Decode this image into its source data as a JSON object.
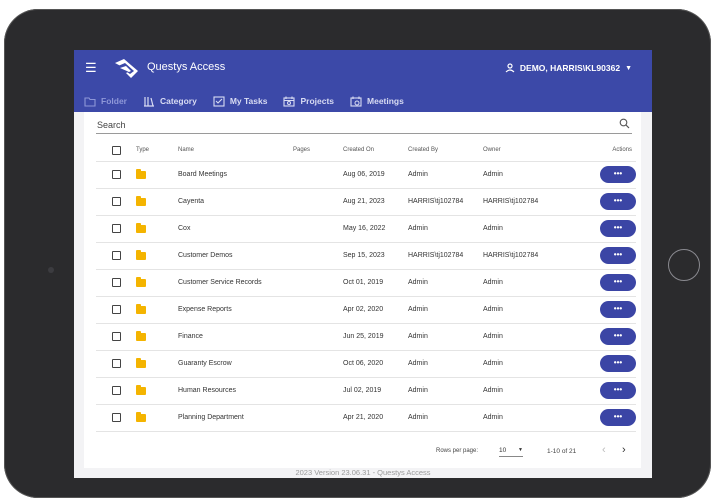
{
  "app": {
    "title": "Questys Access",
    "user_label": "DEMO, HARRIS\\KL90362"
  },
  "tabs": [
    {
      "label": "Folder",
      "icon": "folder-outline-icon"
    },
    {
      "label": "Category",
      "icon": "library-icon"
    },
    {
      "label": "My Tasks",
      "icon": "tasks-icon"
    },
    {
      "label": "Projects",
      "icon": "calendar-icon"
    },
    {
      "label": "Meetings",
      "icon": "calendar-clock-icon"
    }
  ],
  "search": {
    "placeholder": "Search"
  },
  "table": {
    "headers": {
      "type": "Type",
      "name": "Name",
      "pages": "Pages",
      "created_on": "Created On",
      "created_by": "Created By",
      "owner": "Owner",
      "actions": "Actions"
    },
    "rows": [
      {
        "name": "Board Meetings",
        "pages": "",
        "created_on": "Aug 06, 2019",
        "created_by": "Admin",
        "owner": "Admin"
      },
      {
        "name": "Cayenta",
        "pages": "",
        "created_on": "Aug 21, 2023",
        "created_by": "HARRIS\\tj102784",
        "owner": "HARRIS\\tj102784"
      },
      {
        "name": "Cox",
        "pages": "",
        "created_on": "May 16, 2022",
        "created_by": "Admin",
        "owner": "Admin"
      },
      {
        "name": "Customer Demos",
        "pages": "",
        "created_on": "Sep 15, 2023",
        "created_by": "HARRIS\\tj102784",
        "owner": "HARRIS\\tj102784"
      },
      {
        "name": "Customer Service Records",
        "pages": "",
        "created_on": "Oct 01, 2019",
        "created_by": "Admin",
        "owner": "Admin"
      },
      {
        "name": "Expense Reports",
        "pages": "",
        "created_on": "Apr 02, 2020",
        "created_by": "Admin",
        "owner": "Admin"
      },
      {
        "name": "Finance",
        "pages": "",
        "created_on": "Jun 25, 2019",
        "created_by": "Admin",
        "owner": "Admin"
      },
      {
        "name": "Guaranty Escrow",
        "pages": "",
        "created_on": "Oct 06, 2020",
        "created_by": "Admin",
        "owner": "Admin"
      },
      {
        "name": "Human Resources",
        "pages": "",
        "created_on": "Jul 02, 2019",
        "created_by": "Admin",
        "owner": "Admin"
      },
      {
        "name": "Planning Department",
        "pages": "",
        "created_on": "Apr 21, 2020",
        "created_by": "Admin",
        "owner": "Admin"
      }
    ],
    "action_label": "•••"
  },
  "pagination": {
    "rows_per_page_label": "Rows per page:",
    "rows_per_page": "10",
    "range": "1-10 of 21",
    "prev": "‹",
    "next": "›"
  },
  "footer": {
    "version": "2023 Version 23.06.31 - Questys Access"
  },
  "colors": {
    "appbar": "#3c49a8",
    "action_button": "#3b45a5",
    "folder": "#f4b400"
  }
}
